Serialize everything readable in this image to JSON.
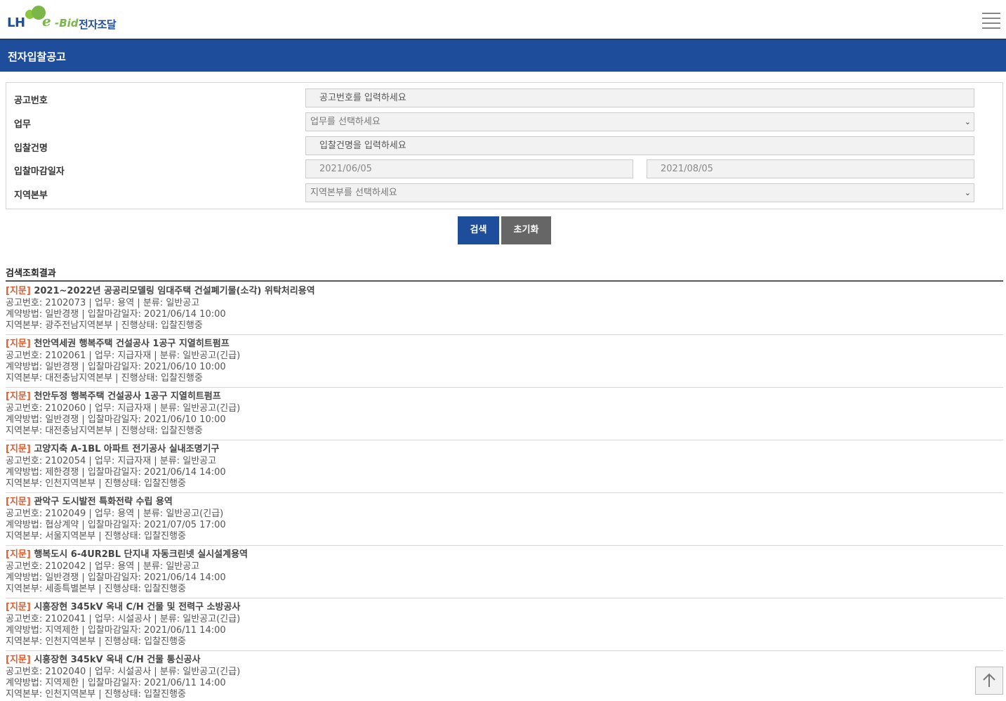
{
  "header": {
    "logo_lh": "LH",
    "logo_e": "e",
    "logo_bid": "-Bid",
    "logo_korean": "전자조달",
    "menu_icon": "hamburger-menu-icon"
  },
  "page_title": "전자입찰공고",
  "form": {
    "notice_no": {
      "label": "공고번호",
      "placeholder": "공고번호를 입력하세요"
    },
    "business": {
      "label": "업무",
      "value": "업무를 선택하세요"
    },
    "bid_name": {
      "label": "입찰건명",
      "placeholder": "입찰건명을 입력하세요"
    },
    "deadline": {
      "label": "입찰마감일자",
      "from": "2021/06/05",
      "to": "2021/08/05"
    },
    "region": {
      "label": "지역본부",
      "value": "지역본부를 선택하세요"
    }
  },
  "buttons": {
    "search": "검색",
    "reset": "초기화"
  },
  "results": {
    "title": "검색조회결과",
    "items": [
      {
        "tag": "[지문]",
        "title": "2021~2022년 공공리모델링 임대주택 건설폐기물(소각) 위탁처리용역",
        "line1": "공고번호: 2102073 | 업무: 용역 | 분류: 일반공고",
        "line2": "계약방법: 일반경쟁 | 입찰마감일자: 2021/06/14 10:00",
        "line3": "지역본부: 광주전남지역본부 | 진행상태: 입찰진행중"
      },
      {
        "tag": "[지문]",
        "title": "천안역세권 행복주택 건설공사 1공구 지열히트펌프",
        "line1": "공고번호: 2102061 | 업무: 지급자재 | 분류: 일반공고(긴급)",
        "line2": "계약방법: 일반경쟁 | 입찰마감일자: 2021/06/10 10:00",
        "line3": "지역본부: 대전충남지역본부 | 진행상태: 입찰진행중"
      },
      {
        "tag": "[지문]",
        "title": "천안두정 행복주택 건설공사 1공구 지열히트펌프",
        "line1": "공고번호: 2102060 | 업무: 지급자재 | 분류: 일반공고(긴급)",
        "line2": "계약방법: 일반경쟁 | 입찰마감일자: 2021/06/10 10:00",
        "line3": "지역본부: 대전충남지역본부 | 진행상태: 입찰진행중"
      },
      {
        "tag": "[지문]",
        "title": "고양지축 A-1BL 아파트 전기공사 실내조명기구",
        "line1": "공고번호: 2102054 | 업무: 지급자재 | 분류: 일반공고",
        "line2": "계약방법: 제한경쟁 | 입찰마감일자: 2021/06/14 14:00",
        "line3": "지역본부: 인천지역본부 | 진행상태: 입찰진행중"
      },
      {
        "tag": "[지문]",
        "title": "관악구 도시발전 특화전략 수립 용역",
        "line1": "공고번호: 2102049 | 업무: 용역 | 분류: 일반공고(긴급)",
        "line2": "계약방법: 협상계약 | 입찰마감일자: 2021/07/05 17:00",
        "line3": "지역본부: 서울지역본부 | 진행상태: 입찰진행중"
      },
      {
        "tag": "[지문]",
        "title": "행복도시 6-4UR2BL 단지내 자동크린넷 실시설계용역",
        "line1": "공고번호: 2102042 | 업무: 용역 | 분류: 일반공고",
        "line2": "계약방법: 일반경쟁 | 입찰마감일자: 2021/06/14 14:00",
        "line3": "지역본부: 세종특별본부 | 진행상태: 입찰진행중"
      },
      {
        "tag": "[지문]",
        "title": "시흥장현 345kV 옥내 C/H 건물 및 전력구 소방공사",
        "line1": "공고번호: 2102041 | 업무: 시설공사 | 분류: 일반공고(긴급)",
        "line2": "계약방법: 지역제한 | 입찰마감일자: 2021/06/11 14:00",
        "line3": "지역본부: 인천지역본부 | 진행상태: 입찰진행중"
      },
      {
        "tag": "[지문]",
        "title": "시흥장현 345kV 옥내 C/H 건물 통신공사",
        "line1": "공고번호: 2102040 | 업무: 시설공사 | 분류: 일반공고(긴급)",
        "line2": "계약방법: 지역제한 | 입찰마감일자: 2021/06/11 14:00",
        "line3": "지역본부: 인천지역본부 | 진행상태: 입찰진행중"
      }
    ]
  },
  "scroll_top_icon": "arrow-up-icon",
  "colors": {
    "brand_blue": "#1e4d9b",
    "tag_orange": "#e35b2c",
    "logo_green": "#7ab648",
    "reset_gray": "#666666"
  }
}
